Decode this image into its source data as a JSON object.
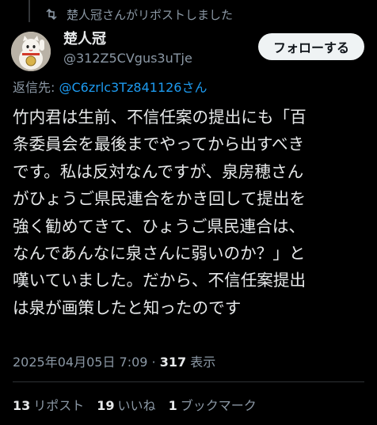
{
  "repost": {
    "label": "楚人冠さんがリポストしました"
  },
  "author": {
    "name": "楚人冠",
    "handle": "@312Z5CVgus3uTje"
  },
  "follow_button": "フォローする",
  "reply": {
    "prefix": "返信先: ",
    "mention": "@C6zrlc3Tz841126さん"
  },
  "post": {
    "text": "竹内君は生前、不信任案の提出にも「百\n条委員会を最後までやってから出すべき\nです。私は反対なんですが、泉房穂さん\nがひょうご県民連合をかき回して提出を\n強く勧めてきて、ひょうご県民連合は、\nなんであんなに泉さんに弱いのか？」と\n嘆いていました。だから、不信任案提出\nは泉が画策したと知ったのです"
  },
  "meta": {
    "timestamp": "2025年04月05日 7:09",
    "separator": " · ",
    "views": "317",
    "views_label": " 表示"
  },
  "stats": [
    {
      "count": "13",
      "label": "リポスト"
    },
    {
      "count": "19",
      "label": "いいね"
    },
    {
      "count": "1",
      "label": "ブックマーク"
    }
  ],
  "colors": {
    "background": "#000000",
    "text": "#e7e9ea",
    "muted": "#8b98a5",
    "link": "#1d9bf0"
  }
}
